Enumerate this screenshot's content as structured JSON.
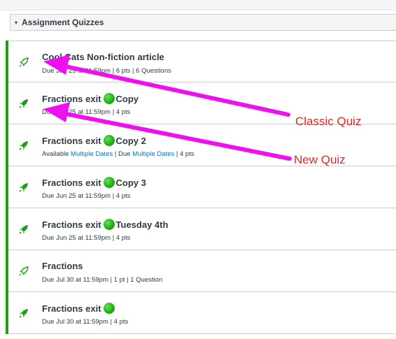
{
  "group": {
    "title": "Assignment Quizzes",
    "toggle_glyph": "▾"
  },
  "quizzes": [
    {
      "name": "Cool Cats Non-fiction article",
      "has_dot": false,
      "suffix": "",
      "icon": "rocket-outline-icon",
      "meta": [
        {
          "text": "Due Jun 25 at 11:59pm",
          "link": false
        },
        {
          "text": " | ",
          "link": false
        },
        {
          "text": "6 pts",
          "link": false
        },
        {
          "text": " | ",
          "link": false
        },
        {
          "text": "6 Questions",
          "link": false
        }
      ]
    },
    {
      "name": "Fractions exit",
      "has_dot": true,
      "suffix": "Copy",
      "icon": "rocket-solid-icon",
      "meta": [
        {
          "text": "Due Jun 25 at 11:59pm",
          "link": false
        },
        {
          "text": " | ",
          "link": false
        },
        {
          "text": "4 pts",
          "link": false
        }
      ]
    },
    {
      "name": "Fractions exit",
      "has_dot": true,
      "suffix": "Copy 2",
      "icon": "rocket-solid-icon",
      "meta": [
        {
          "text": "Available ",
          "link": false
        },
        {
          "text": "Multiple Dates",
          "link": true
        },
        {
          "text": " | Due ",
          "link": false
        },
        {
          "text": "Multiple Dates",
          "link": true
        },
        {
          "text": " | 4 pts",
          "link": false
        }
      ]
    },
    {
      "name": "Fractions exit",
      "has_dot": true,
      "suffix": "Copy 3",
      "icon": "rocket-solid-icon",
      "meta": [
        {
          "text": "Due Jun 25 at 11:59pm",
          "link": false
        },
        {
          "text": " | ",
          "link": false
        },
        {
          "text": "4 pts",
          "link": false
        }
      ]
    },
    {
      "name": "Fractions exit",
      "has_dot": true,
      "suffix": "Tuesday 4th",
      "icon": "rocket-solid-icon",
      "meta": [
        {
          "text": "Due Jun 25 at 11:59pm",
          "link": false
        },
        {
          "text": " | ",
          "link": false
        },
        {
          "text": "4 pts",
          "link": false
        }
      ]
    },
    {
      "name": "Fractions",
      "has_dot": false,
      "suffix": "",
      "icon": "rocket-outline-icon",
      "meta": [
        {
          "text": "Due Jul 30 at 11:59pm",
          "link": false
        },
        {
          "text": " | ",
          "link": false
        },
        {
          "text": "1 pt",
          "link": false
        },
        {
          "text": " | ",
          "link": false
        },
        {
          "text": "1 Question",
          "link": false
        }
      ]
    },
    {
      "name": "Fractions exit",
      "has_dot": true,
      "suffix": "",
      "icon": "rocket-solid-icon",
      "meta": [
        {
          "text": "Due Jul 30 at 11:59pm",
          "link": false
        },
        {
          "text": " | ",
          "link": false
        },
        {
          "text": "4 pts",
          "link": false
        }
      ]
    }
  ],
  "annotations": {
    "classic": "Classic Quiz",
    "new": "New Quiz"
  },
  "colors": {
    "accent_green": "#1fa012",
    "annotation_magenta": "#ee10ee",
    "annotation_red": "#e8262a",
    "link_blue": "#0077c2"
  }
}
